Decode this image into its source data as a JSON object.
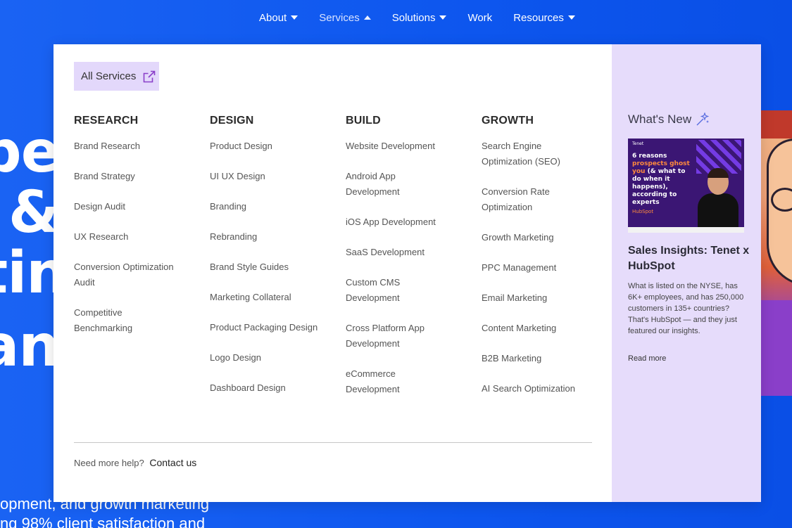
{
  "nav": {
    "items": [
      {
        "label": "About",
        "caret": "down"
      },
      {
        "label": "Services",
        "caret": "up",
        "active": true
      },
      {
        "label": "Solutions",
        "caret": "down"
      },
      {
        "label": "Work",
        "caret": "none"
      },
      {
        "label": "Resources",
        "caret": "down"
      }
    ]
  },
  "hero": {
    "fragments": [
      "pe",
      "&",
      "tin",
      "any"
    ],
    "sub_lines": [
      "opment, and growth marketing",
      "ng 98% client satisfaction and"
    ]
  },
  "dropdown": {
    "all_services_label": "All Services",
    "columns": [
      {
        "heading": "RESEARCH",
        "links": [
          "Brand Research",
          "Brand Strategy",
          "Design Audit",
          "UX Research",
          "Conversion Optimization Audit",
          "Competitive Benchmarking"
        ]
      },
      {
        "heading": "DESIGN",
        "links": [
          "Product Design",
          "UI UX Design",
          "Branding",
          "Rebranding",
          "Brand Style Guides",
          "Marketing Collateral",
          "Product Packaging Design",
          "Logo Design",
          "Dashboard Design"
        ]
      },
      {
        "heading": "BUILD",
        "links": [
          "Website Development",
          "Android App Development",
          "iOS App Development",
          "SaaS Development",
          "Custom CMS Development",
          "Cross Platform App Development",
          "eCommerce Development"
        ]
      },
      {
        "heading": "GROWTH",
        "links": [
          "Search Engine Optimization (SEO)",
          "Conversion Rate Optimization",
          "Growth Marketing",
          "PPC Management",
          "Email Marketing",
          "Content Marketing",
          "B2B Marketing",
          "AI Search Optimization"
        ]
      }
    ],
    "help_text": "Need more help?",
    "contact_label": "Contact us"
  },
  "whats_new": {
    "heading": "What's New",
    "thumb": {
      "brand": "Tenet",
      "line1": "6 reasons",
      "line2": "prospects ghost",
      "line3": "you",
      "line4": "(& what to do when it happens), according to experts",
      "footer": "HubSpot"
    },
    "title": "Sales Insights: Tenet x HubSpot",
    "description": "What is listed on the NYSE, has 6K+ employees, and has 250,000 customers in 135+ countries? That's HubSpot — and they just featured our insights.",
    "read_more": "Read more"
  },
  "colors": {
    "background": "#0f5cf2",
    "panel": "#ffffff",
    "side_panel": "#e6dcfb",
    "accent": "#8a3fc9"
  },
  "icons": {
    "all_services": "external-link-icon",
    "whats_new": "sparkle-icon",
    "nav_caret": "caret-icon"
  }
}
